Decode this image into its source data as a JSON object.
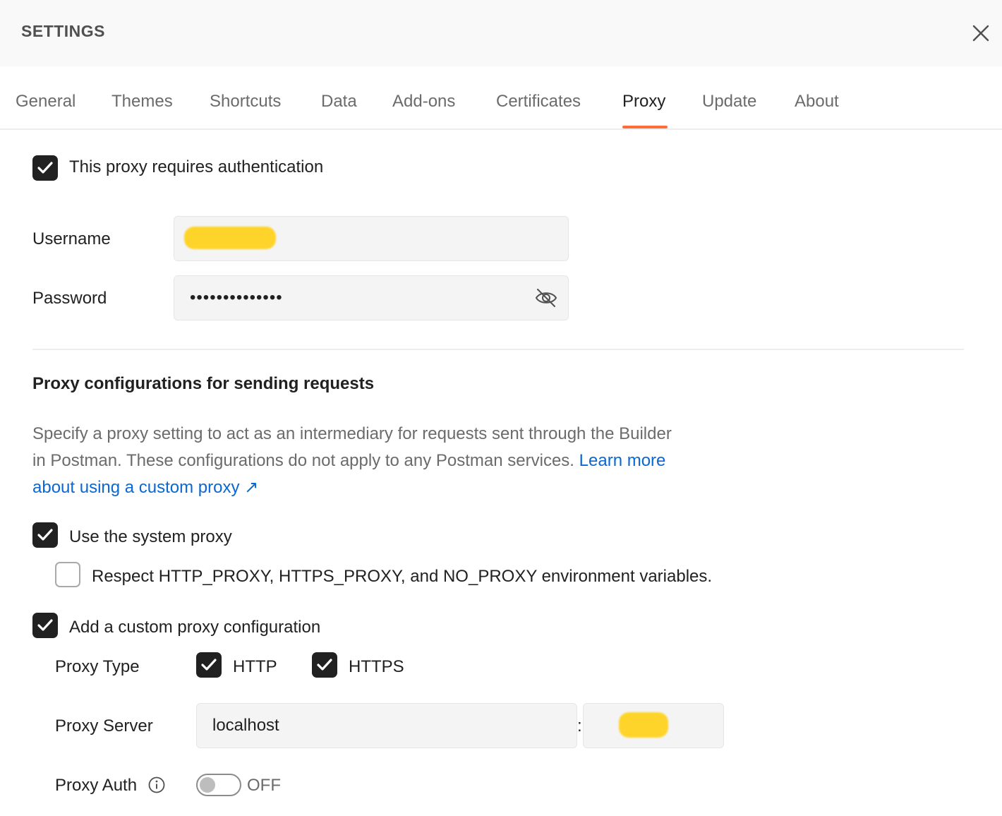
{
  "header": {
    "title": "SETTINGS"
  },
  "tabs": [
    {
      "label": "General"
    },
    {
      "label": "Themes"
    },
    {
      "label": "Shortcuts"
    },
    {
      "label": "Data"
    },
    {
      "label": "Add-ons"
    },
    {
      "label": "Certificates"
    },
    {
      "label": "Proxy",
      "active": true
    },
    {
      "label": "Update"
    },
    {
      "label": "About"
    }
  ],
  "auth": {
    "requires_auth_label": "This proxy requires authentication",
    "requires_auth_checked": true,
    "username_label": "Username",
    "password_label": "Password",
    "password_value": "••••••••••••••"
  },
  "proxy_config": {
    "section_title": "Proxy configurations for sending requests",
    "description": "Specify a proxy setting to act as an intermediary for requests sent through the Builder in Postman. These configurations do not apply to any Postman services.",
    "learn_more_link": "Learn more about using a custom proxy ↗",
    "system_proxy_label": "Use the system proxy",
    "system_proxy_checked": true,
    "env_vars_label": "Respect HTTP_PROXY, HTTPS_PROXY, and NO_PROXY environment variables.",
    "env_vars_checked": false,
    "custom_proxy_label": "Add a custom proxy configuration",
    "custom_proxy_checked": true,
    "proxy_type_label": "Proxy Type",
    "http_label": "HTTP",
    "http_checked": true,
    "https_label": "HTTPS",
    "https_checked": true,
    "proxy_server_label": "Proxy Server",
    "proxy_server_value": "localhost",
    "port_separator": ":",
    "proxy_auth_label": "Proxy Auth",
    "proxy_auth_state": "OFF"
  },
  "colors": {
    "accent": "#ff6c37",
    "link": "#0b67d1",
    "redaction": "#ffd42a"
  }
}
